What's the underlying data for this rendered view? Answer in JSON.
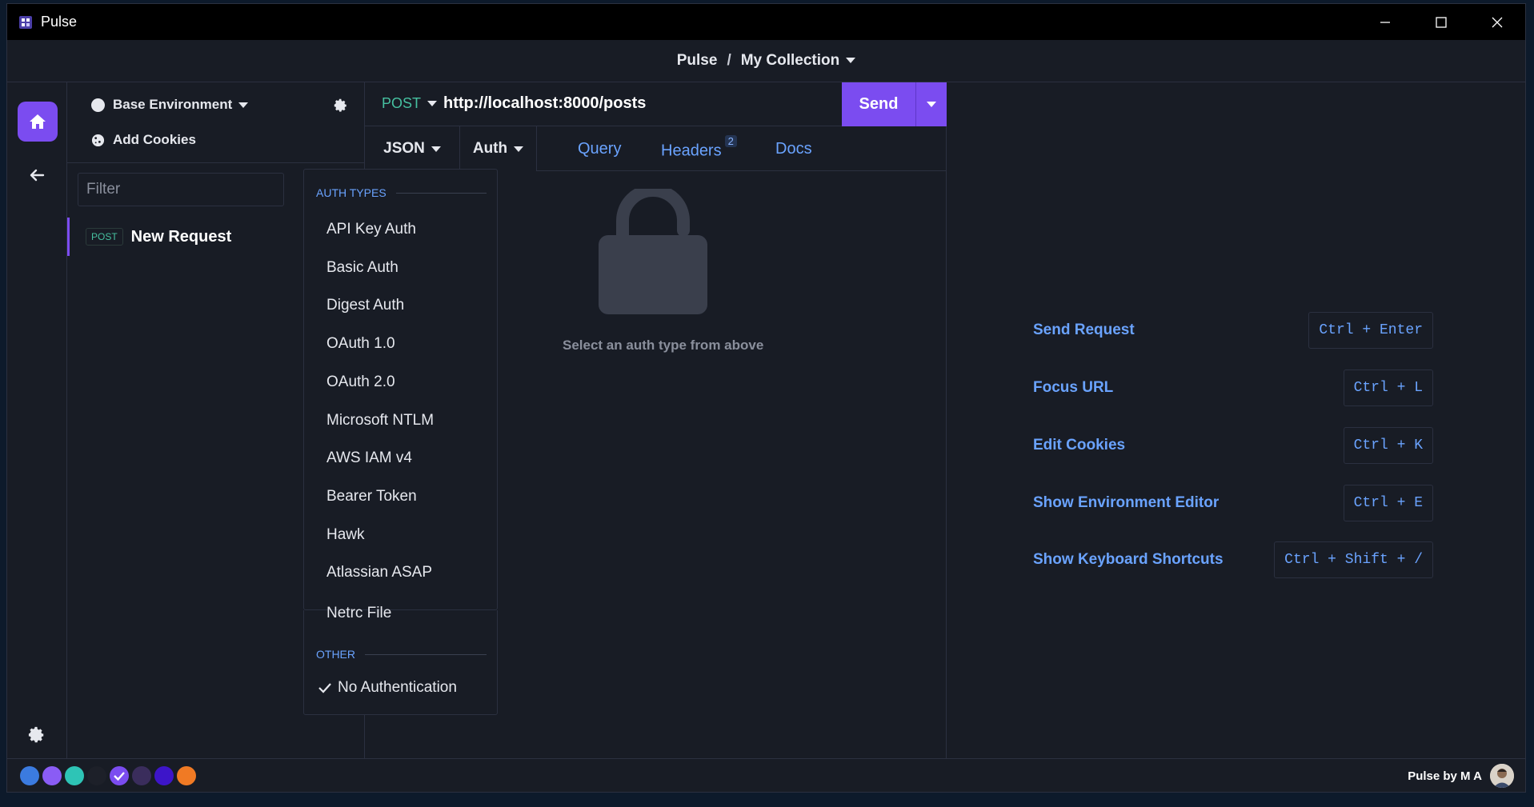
{
  "window": {
    "title": "Pulse"
  },
  "header": {
    "app_name": "Pulse",
    "separator": "/",
    "collection": "My Collection"
  },
  "sidebar": {
    "environment": "Base Environment",
    "add_cookies": "Add Cookies",
    "filter_placeholder": "Filter",
    "requests": [
      {
        "method": "POST",
        "name": "New Request"
      }
    ]
  },
  "request": {
    "method": "POST",
    "url": "http://localhost:8000/posts",
    "send_label": "Send",
    "tabs": {
      "body": "JSON",
      "auth": "Auth",
      "query": "Query",
      "headers": "Headers",
      "headers_count": "2",
      "docs": "Docs"
    },
    "auth_empty_text": "Select an auth type from above"
  },
  "auth_menu": {
    "section_auth_types": "AUTH TYPES",
    "items": [
      "API Key Auth",
      "Basic Auth",
      "Digest Auth",
      "OAuth 1.0",
      "OAuth 2.0",
      "Microsoft NTLM",
      "AWS IAM v4",
      "Bearer Token",
      "Hawk",
      "Atlassian ASAP",
      "Netrc File"
    ],
    "section_other": "OTHER",
    "selected_item": "No Authentication"
  },
  "shortcuts": [
    {
      "label": "Send Request",
      "keys": "Ctrl + Enter"
    },
    {
      "label": "Focus URL",
      "keys": "Ctrl + L"
    },
    {
      "label": "Edit Cookies",
      "keys": "Ctrl + K"
    },
    {
      "label": "Show Environment Editor",
      "keys": "Ctrl + E"
    },
    {
      "label": "Show Keyboard Shortcuts",
      "keys": "Ctrl + Shift + /"
    }
  ],
  "status": {
    "credit": "Pulse by M A",
    "theme_swatches": [
      "#3b7be0",
      "#8a5cf5",
      "#2ec4b6",
      "#1d2029",
      "#7b4cf0",
      "#3a2d5c",
      "#3d15c9",
      "#f07a24"
    ],
    "selected_swatch_index": 4
  },
  "colors": {
    "accent": "#7b4cf0",
    "link": "#6aa3ff",
    "method_post": "#46c0a0",
    "background": "#181c25"
  }
}
